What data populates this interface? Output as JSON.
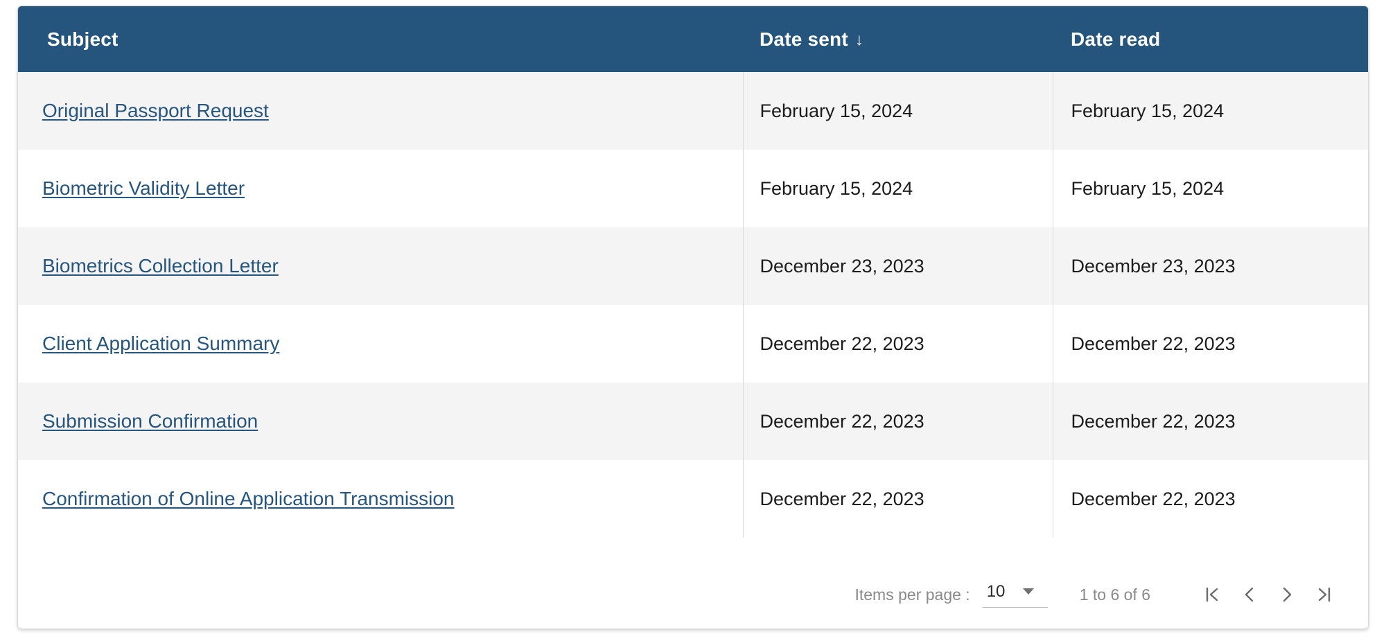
{
  "table": {
    "columns": [
      {
        "key": "subject",
        "label": "Subject",
        "sort": null
      },
      {
        "key": "date_sent",
        "label": "Date sent",
        "sort": "desc",
        "sort_icon": "arrow-down-icon"
      },
      {
        "key": "date_read",
        "label": "Date read",
        "sort": null
      }
    ],
    "rows": [
      {
        "subject": "Original Passport Request",
        "date_sent": "February 15, 2024",
        "date_read": "February 15, 2024"
      },
      {
        "subject": "Biometric Validity Letter",
        "date_sent": "February 15, 2024",
        "date_read": "February 15, 2024"
      },
      {
        "subject": "Biometrics Collection Letter",
        "date_sent": "December 23, 2023",
        "date_read": "December 23, 2023"
      },
      {
        "subject": "Client Application Summary",
        "date_sent": "December 22, 2023",
        "date_read": "December 22, 2023"
      },
      {
        "subject": "Submission Confirmation",
        "date_sent": "December 22, 2023",
        "date_read": "December 22, 2023"
      },
      {
        "subject": "Confirmation of Online Application Transmission",
        "date_sent": "December 22, 2023",
        "date_read": "December 22, 2023"
      }
    ]
  },
  "paginator": {
    "items_per_page_label": "Items per page :",
    "items_per_page_value": "10",
    "items_per_page_options": [
      "10"
    ],
    "range_label": "1 to 6 of 6",
    "buttons": [
      {
        "name": "first-page-button",
        "icon": "first-page-icon"
      },
      {
        "name": "previous-page-button",
        "icon": "chevron-left-icon"
      },
      {
        "name": "next-page-button",
        "icon": "chevron-right-icon"
      },
      {
        "name": "last-page-button",
        "icon": "last-page-icon"
      }
    ]
  },
  "colors": {
    "header_background": "#25557c",
    "link": "#26557e",
    "row_stripe": "#f4f4f4",
    "row_plain": "#ffffff",
    "muted_text": "#8a8a8a"
  }
}
